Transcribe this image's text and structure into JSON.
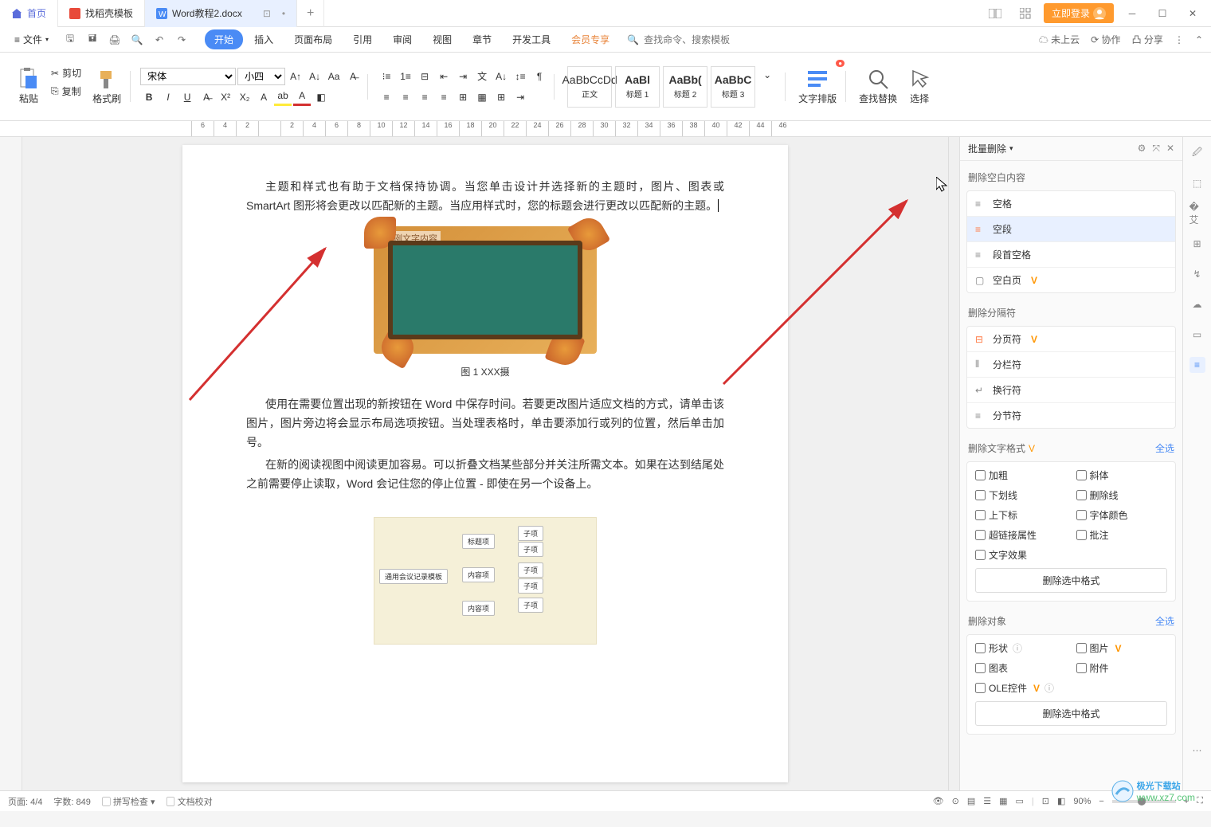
{
  "tabs": {
    "home": "首页",
    "template": "找稻壳模板",
    "active": "Word教程2.docx"
  },
  "titlebar": {
    "login": "立即登录"
  },
  "menubar": {
    "file": "文件",
    "tabs": [
      "开始",
      "插入",
      "页面布局",
      "引用",
      "审阅",
      "视图",
      "章节",
      "开发工具",
      "会员专享"
    ],
    "search_placeholder": "查找命令、搜索模板",
    "cloud": "未上云",
    "coop": "协作",
    "share": "分享"
  },
  "ribbon": {
    "paste": "粘贴",
    "cut": "剪切",
    "copy": "复制",
    "format_painter": "格式刷",
    "font_name": "宋体",
    "font_size": "小四",
    "styles": [
      {
        "preview": "AaBbCcDd",
        "name": "正文"
      },
      {
        "preview": "AaBl",
        "name": "标题 1"
      },
      {
        "preview": "AaBb(",
        "name": "标题 2"
      },
      {
        "preview": "AaBbC",
        "name": "标题 3"
      }
    ],
    "text_layout": "文字排版",
    "find_replace": "查找替换",
    "select": "选择"
  },
  "ruler": [
    "6",
    "4",
    "2",
    "",
    "2",
    "4",
    "6",
    "8",
    "10",
    "12",
    "14",
    "16",
    "18",
    "20",
    "22",
    "24",
    "26",
    "28",
    "30",
    "32",
    "34",
    "36",
    "38",
    "40",
    "42",
    "44",
    "46"
  ],
  "doc": {
    "para1": "主题和样式也有助于文档保持协调。当您单击设计并选择新的主题时，图片、图表或 SmartArt 图形将会更改以匹配新的主题。当应用样式时，您的标题会进行更改以匹配新的主题。",
    "img_label": "举例文字内容",
    "caption": "图 1   XXX摄",
    "para2": "使用在需要位置出现的新按钮在 Word 中保存时间。若要更改图片适应文档的方式，请单击该图片，图片旁边将会显示布局选项按钮。当处理表格时，单击要添加行或列的位置，然后单击加号。",
    "para3": "在新的阅读视图中阅读更加容易。可以折叠文档某些部分并关注所需文本。如果在达到结尾处之前需要停止读取，Word 会记住您的停止位置 - 即使在另一个设备上。",
    "mm_root": "通用会议记录模板"
  },
  "panel": {
    "title": "批量删除",
    "sec1_title": "删除空白内容",
    "sec1": [
      {
        "label": "空格",
        "icon": "≡"
      },
      {
        "label": "空段",
        "icon": "≡",
        "selected": true,
        "orange": true
      },
      {
        "label": "段首空格",
        "icon": "≡"
      },
      {
        "label": "空白页",
        "icon": "▢",
        "vip": true
      }
    ],
    "sec2_title": "删除分隔符",
    "sec2": [
      {
        "label": "分页符",
        "icon": "⊟",
        "vip": true,
        "orange": true
      },
      {
        "label": "分栏符",
        "icon": "⦀"
      },
      {
        "label": "换行符",
        "icon": "↵"
      },
      {
        "label": "分节符",
        "icon": "≡"
      }
    ],
    "sec3_title": "删除文字格式",
    "sec3_vip": true,
    "select_all": "全选",
    "checks1": [
      {
        "left": "加粗",
        "right": "斜体"
      },
      {
        "left": "下划线",
        "right": "删除线"
      },
      {
        "left": "上下标",
        "right": "字体颜色"
      },
      {
        "left": "超链接属性",
        "right": "批注"
      },
      {
        "left": "文字效果",
        "right": ""
      }
    ],
    "btn1": "删除选中格式",
    "sec4_title": "删除对象",
    "checks2": [
      {
        "left": "形状",
        "left_info": true,
        "right": "图片",
        "right_vip": true
      },
      {
        "left": "图表",
        "right": "附件"
      },
      {
        "left": "OLE控件",
        "left_vip": true,
        "left_info": true,
        "right": ""
      }
    ],
    "btn2": "删除选中格式"
  },
  "status": {
    "page": "页面: 4/4",
    "words": "字数: 849",
    "spell": "拼写检查",
    "proof": "文档校对",
    "zoom": "90%"
  },
  "watermark": {
    "site": "极光下载站",
    "url": "www.xz7.com"
  }
}
